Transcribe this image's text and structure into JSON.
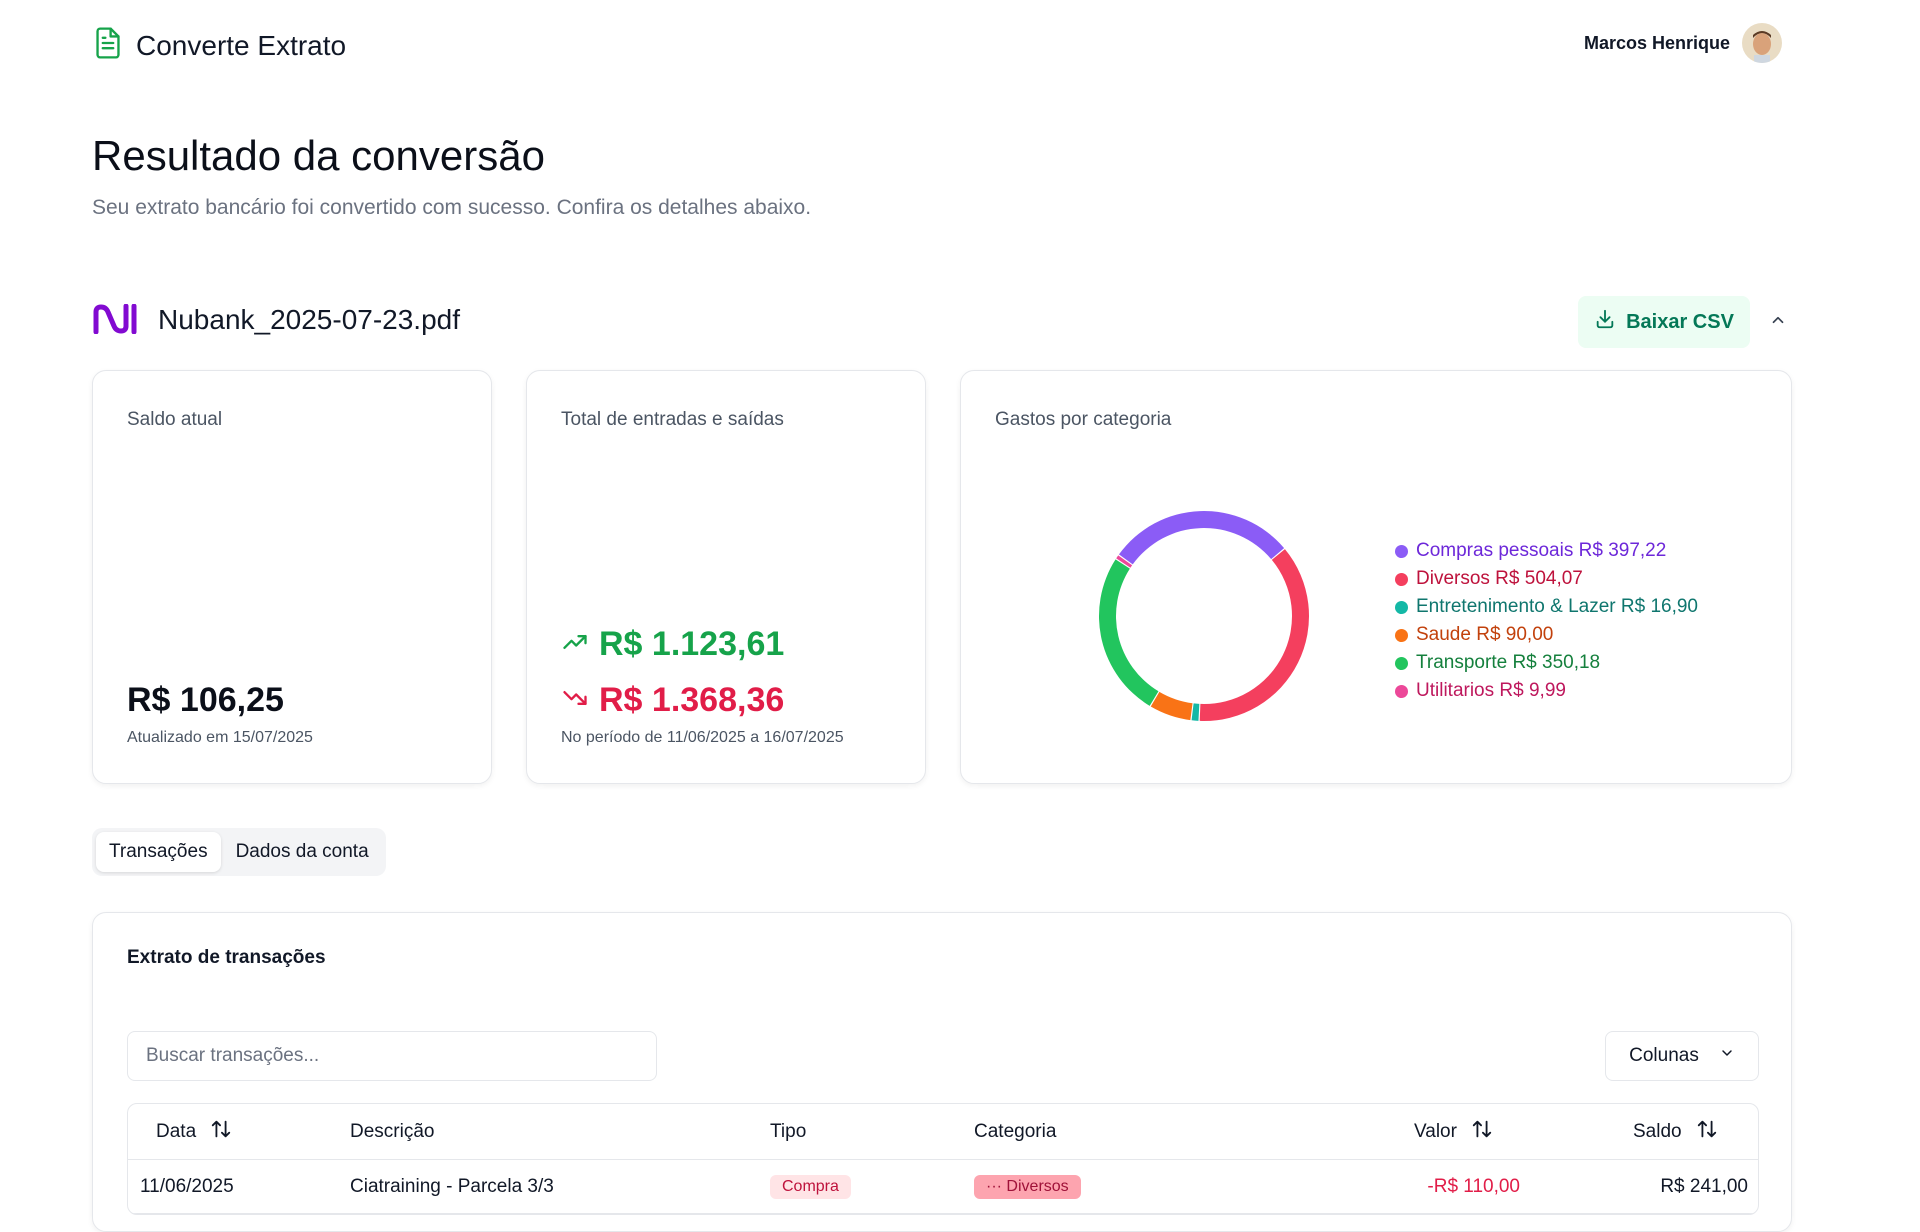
{
  "header": {
    "app_name": "Converte Extrato",
    "user_name": "Marcos Henrique"
  },
  "page": {
    "title": "Resultado da conversão",
    "subtitle": "Seu extrato bancário foi convertido com sucesso. Confira os detalhes abaixo."
  },
  "file": {
    "name": "Nubank_2025-07-23.pdf",
    "download_label": "Baixar CSV"
  },
  "cards": {
    "balance": {
      "title": "Saldo atual",
      "value": "R$ 106,25",
      "note": "Atualizado em 15/07/2025"
    },
    "flows": {
      "title": "Total de entradas e saídas",
      "income": "R$ 1.123,61",
      "expense": "R$ 1.368,36",
      "note": "No período de 11/06/2025 a 16/07/2025"
    },
    "categories": {
      "title": "Gastos por categoria",
      "items": [
        {
          "label": "Compras pessoais R$ 397,22",
          "value": 397.22,
          "color": "#8b5cf6",
          "text_color": "#6d28d9"
        },
        {
          "label": "Diversos R$ 504,07",
          "value": 504.07,
          "color": "#f43f5e",
          "text_color": "#be123c"
        },
        {
          "label": "Entretenimento & Lazer R$ 16,90",
          "value": 16.9,
          "color": "#14b8a6",
          "text_color": "#0f766e"
        },
        {
          "label": "Saude R$ 90,00",
          "value": 90.0,
          "color": "#f97316",
          "text_color": "#c2410c"
        },
        {
          "label": "Transporte R$ 350,18",
          "value": 350.18,
          "color": "#22c55e",
          "text_color": "#15803d"
        },
        {
          "label": "Utilitarios R$ 9,99",
          "value": 9.99,
          "color": "#ec4899",
          "text_color": "#be185d"
        }
      ]
    }
  },
  "tabs": [
    {
      "label": "Transações",
      "active": true
    },
    {
      "label": "Dados da conta",
      "active": false
    }
  ],
  "transactions": {
    "title": "Extrato de transações",
    "search_placeholder": "Buscar transações...",
    "columns_label": "Colunas",
    "headers": {
      "date": "Data",
      "description": "Descrição",
      "type": "Tipo",
      "category": "Categoria",
      "value": "Valor",
      "balance": "Saldo"
    },
    "rows": [
      {
        "date": "11/06/2025",
        "description": "Ciatraining - Parcela 3/3",
        "type": "Compra",
        "category": "··· Diversos",
        "value": "-R$ 110,00",
        "balance": "R$ 241,00"
      }
    ]
  },
  "colors": {
    "accent_green": "#16a34a",
    "accent_red": "#e11d48",
    "nubank_purple": "#820ad1"
  }
}
